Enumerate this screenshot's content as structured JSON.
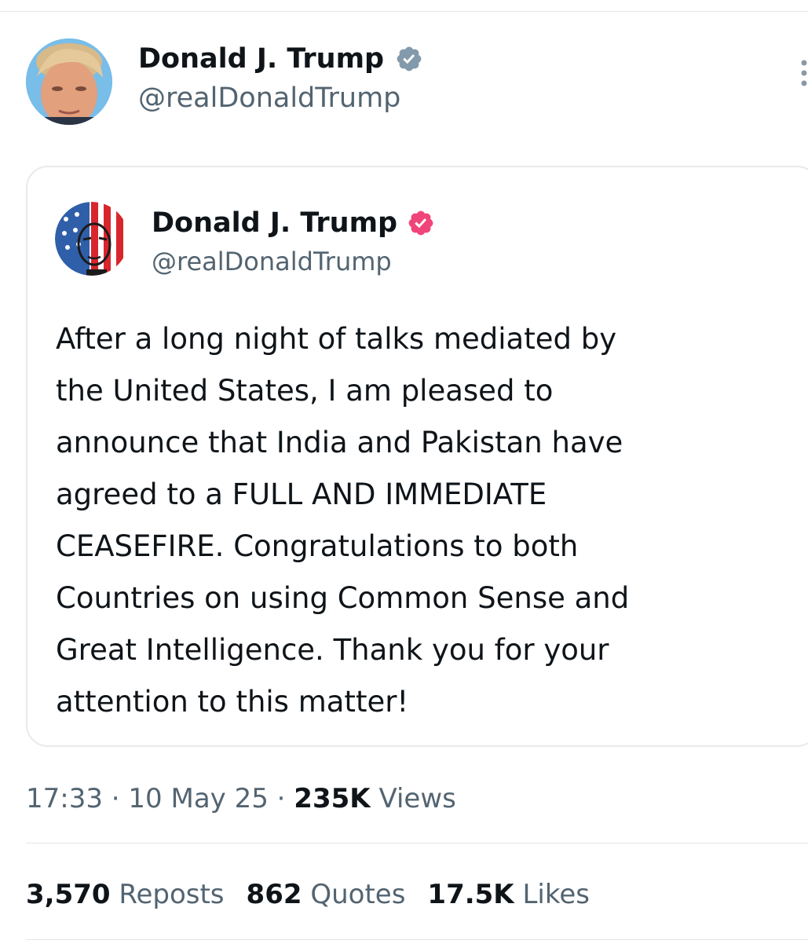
{
  "author": {
    "name": "Donald J. Trump",
    "handle": "@realDonaldTrump",
    "verified_color": "#829aab"
  },
  "quoted_post": {
    "author": {
      "name": "Donald J. Trump",
      "handle": "@realDonaldTrump",
      "verified_color": "#f0457a"
    },
    "text_lines": [
      "After a long night of talks mediated by",
      "the United States, I am pleased to",
      "announce that India and Pakistan have",
      "agreed to a FULL AND IMMEDIATE",
      "CEASEFIRE. Congratulations to both",
      "Countries on using Common Sense and",
      "Great Intelligence. Thank you for your",
      "attention to this matter!"
    ]
  },
  "meta": {
    "time": "17:33",
    "separator": "·",
    "date": "10 May 25",
    "views_count": "235K",
    "views_label": "Views"
  },
  "stats": {
    "reposts_count": "3,570",
    "reposts_label": "Reposts",
    "quotes_count": "862",
    "quotes_label": "Quotes",
    "likes_count": "17.5K",
    "likes_label": "Likes"
  },
  "colors": {
    "text_primary": "#0f1419",
    "text_secondary": "#536471",
    "border": "#e1e6ea"
  }
}
